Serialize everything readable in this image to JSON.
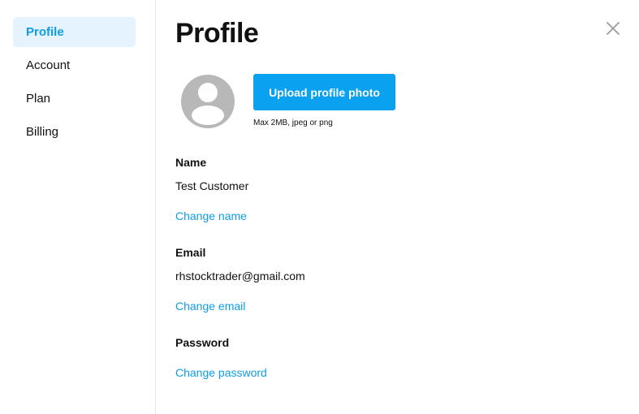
{
  "sidebar": {
    "items": [
      {
        "label": "Profile",
        "active": true
      },
      {
        "label": "Account",
        "active": false
      },
      {
        "label": "Plan",
        "active": false
      },
      {
        "label": "Billing",
        "active": false
      }
    ]
  },
  "page": {
    "title": "Profile",
    "close_icon": "close-icon"
  },
  "photo": {
    "avatar_icon": "default-user-avatar",
    "upload_label": "Upload profile photo",
    "hint": "Max 2MB, jpeg or png"
  },
  "name": {
    "label": "Name",
    "value": "Test Customer",
    "change_link": "Change name"
  },
  "email": {
    "label": "Email",
    "value": "rhstocktrader@gmail.com",
    "change_link": "Change email"
  },
  "password": {
    "label": "Password",
    "change_link": "Change password"
  },
  "colors": {
    "accent": "#09a1f0",
    "link": "#0d9de6",
    "active_nav_bg": "#e4f3fd",
    "avatar_gray": "#b8b8b8"
  }
}
